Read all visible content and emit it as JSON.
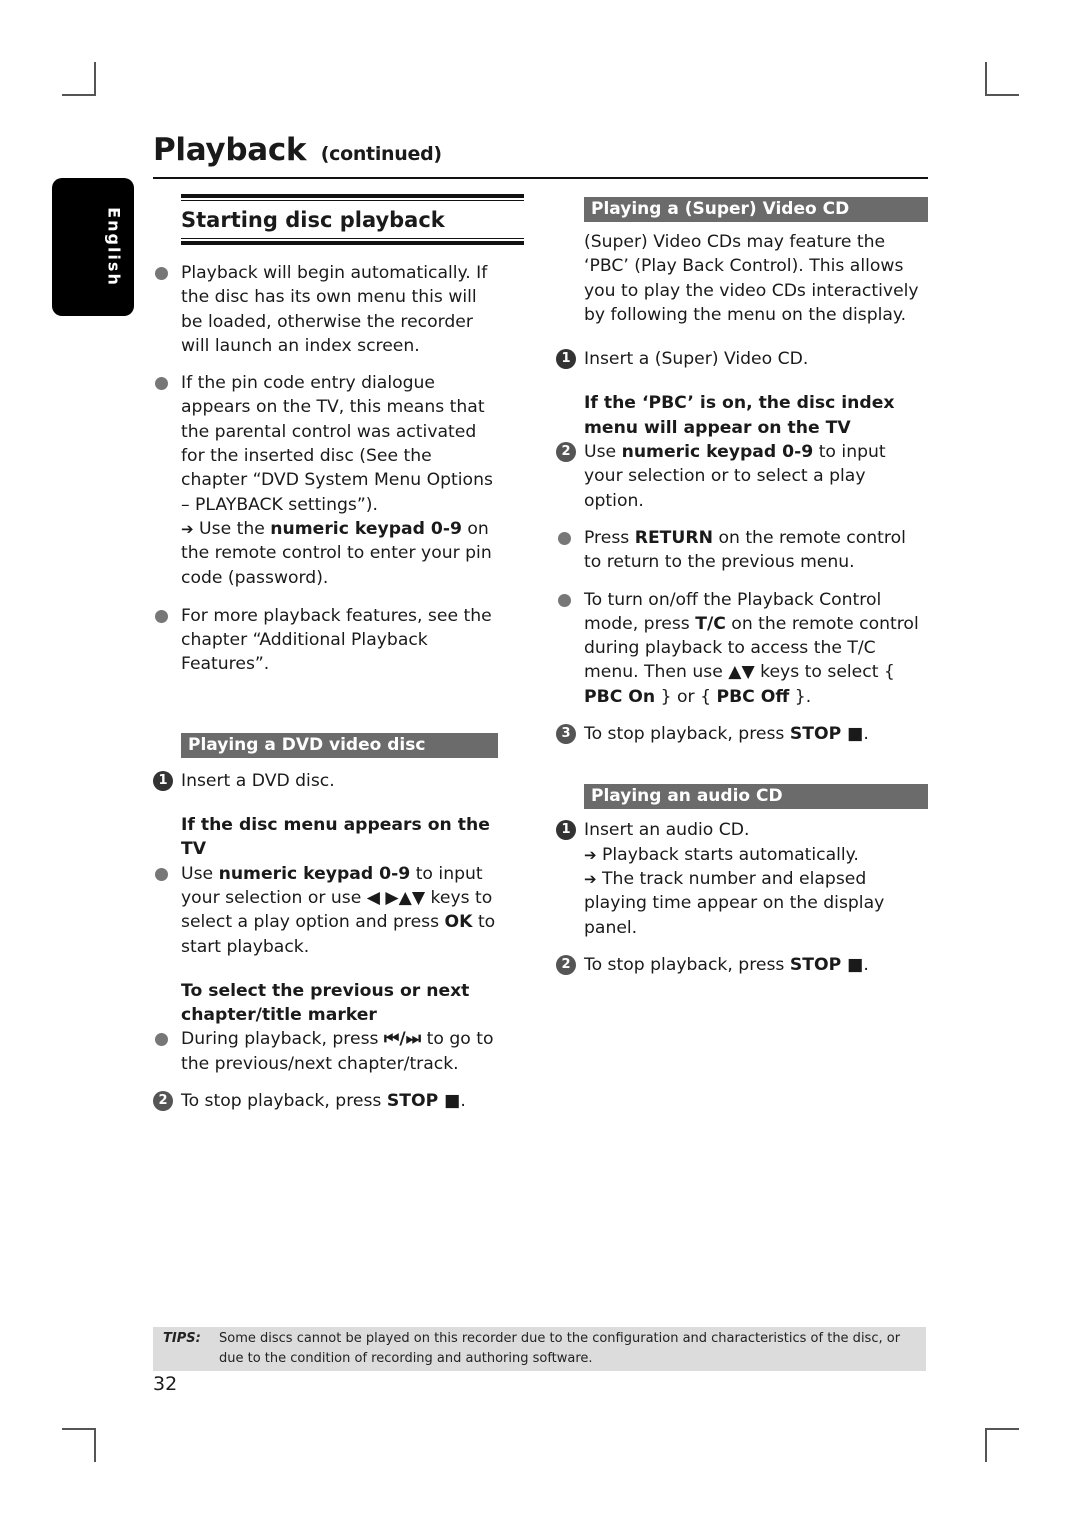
{
  "header": {
    "title": "Playback",
    "title_suffix": "(continued)"
  },
  "language_tab": "English",
  "section": {
    "title": "Starting disc playback"
  },
  "left_column": {
    "intro_bullets": [
      "Playback will begin automatically. If the disc has its own menu this will be loaded, otherwise the recorder will launch an index screen.",
      "If the pin code entry dialogue appears on the TV, this means that the parental control was activated for the inserted disc (See the chapter “DVD System Menu Options – PLAYBACK settings”).",
      "For more playback features, see the chapter “Additional Playback Features”."
    ],
    "pin_note": {
      "arrow": "➔",
      "pre": "Use the ",
      "bold": "numeric keypad 0-9",
      "post": " on the remote control to enter your pin code (password)."
    },
    "dvd": {
      "heading": "Playing a DVD video disc",
      "step1_num": "1",
      "step1": "Insert a DVD disc.",
      "subhead1": "If the disc menu appears on the TV",
      "bullet1_pre": "Use ",
      "bullet1_bold": "numeric keypad 0-9",
      "bullet1_mid": " to input your selection or use ◀ ▶▲▼ keys to select a play option and press ",
      "bullet1_bold2": "OK",
      "bullet1_post": " to start playback.",
      "subhead2": "To select the previous or next chapter/title marker",
      "bullet2_pre": "During playback, press ",
      "bullet2_keys": "⏮/⏭",
      "bullet2_post": " to go to the previous/next chapter/track.",
      "step2_num": "2",
      "step2_pre": "To stop playback, press ",
      "step2_bold": "STOP ■",
      "step2_post": "."
    }
  },
  "right_column": {
    "vcd": {
      "heading": "Playing a (Super) Video CD",
      "intro": "(Super) Video CDs may feature the ‘PBC’ (Play Back Control). This allows you to play the video CDs interactively by following the menu on the display.",
      "step1_num": "1",
      "step1": "Insert a (Super) Video CD.",
      "subhead": "If the ‘PBC’ is on, the disc index menu will appear on the TV",
      "step2_num": "2",
      "step2_pre": "Use ",
      "step2_bold": "numeric keypad 0-9",
      "step2_post": " to input your selection or to select a play option.",
      "bullet1_pre": "Press ",
      "bullet1_bold": "RETURN",
      "bullet1_post": " on the remote control to return to the previous menu.",
      "bullet2_pre": "To turn on/off the Playback Control mode, press ",
      "bullet2_bold": "T/C",
      "bullet2_mid": " on the remote control during playback to access the T/C menu. Then use ▲▼ keys to select { ",
      "bullet2_bold2": "PBC On",
      "bullet2_mid2": " } or { ",
      "bullet2_bold3": "PBC Off",
      "bullet2_post": " }.",
      "step3_num": "3",
      "step3_pre": "To stop playback, press ",
      "step3_bold": "STOP ■",
      "step3_post": "."
    },
    "audio": {
      "heading": "Playing an audio CD",
      "step1_num": "1",
      "step1": "Insert an audio CD.",
      "arrow": "➔",
      "note1": "Playback starts automatically.",
      "note2": "The track number and elapsed playing time appear on the display panel.",
      "step2_num": "2",
      "step2_pre": "To stop playback, press ",
      "step2_bold": "STOP ■",
      "step2_post": "."
    }
  },
  "tips": {
    "label": "TIPS:",
    "text": "Some discs cannot be played on this recorder due to the configuration and characteristics of the disc, or due to the condition of recording and authoring software."
  },
  "page_number": "32"
}
